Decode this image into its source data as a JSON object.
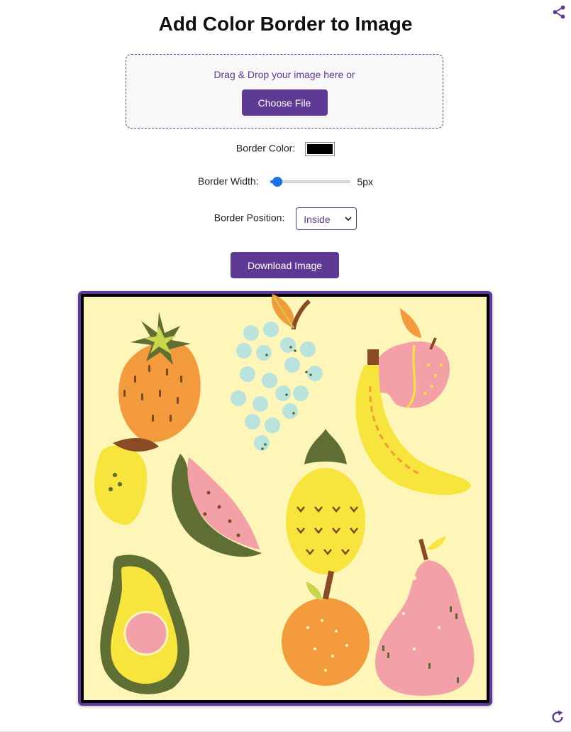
{
  "title": "Add Color Border to Image",
  "dropzone": {
    "text": "Drag & Drop your image here or",
    "choose_label": "Choose File"
  },
  "controls": {
    "border_color_label": "Border Color:",
    "border_color_value": "#000000",
    "border_width_label": "Border Width:",
    "border_width_value": "5px",
    "border_width_level": 0.05,
    "border_position_label": "Border Position:",
    "border_position_value": "Inside"
  },
  "download_label": "Download Image",
  "colors": {
    "accent": "#5f3a94",
    "slider": "#1a73e8",
    "image_background": "#fdf6b8"
  },
  "icons": {
    "share": "share-icon",
    "refresh": "refresh-icon",
    "chevron": "chevron-down-icon"
  }
}
